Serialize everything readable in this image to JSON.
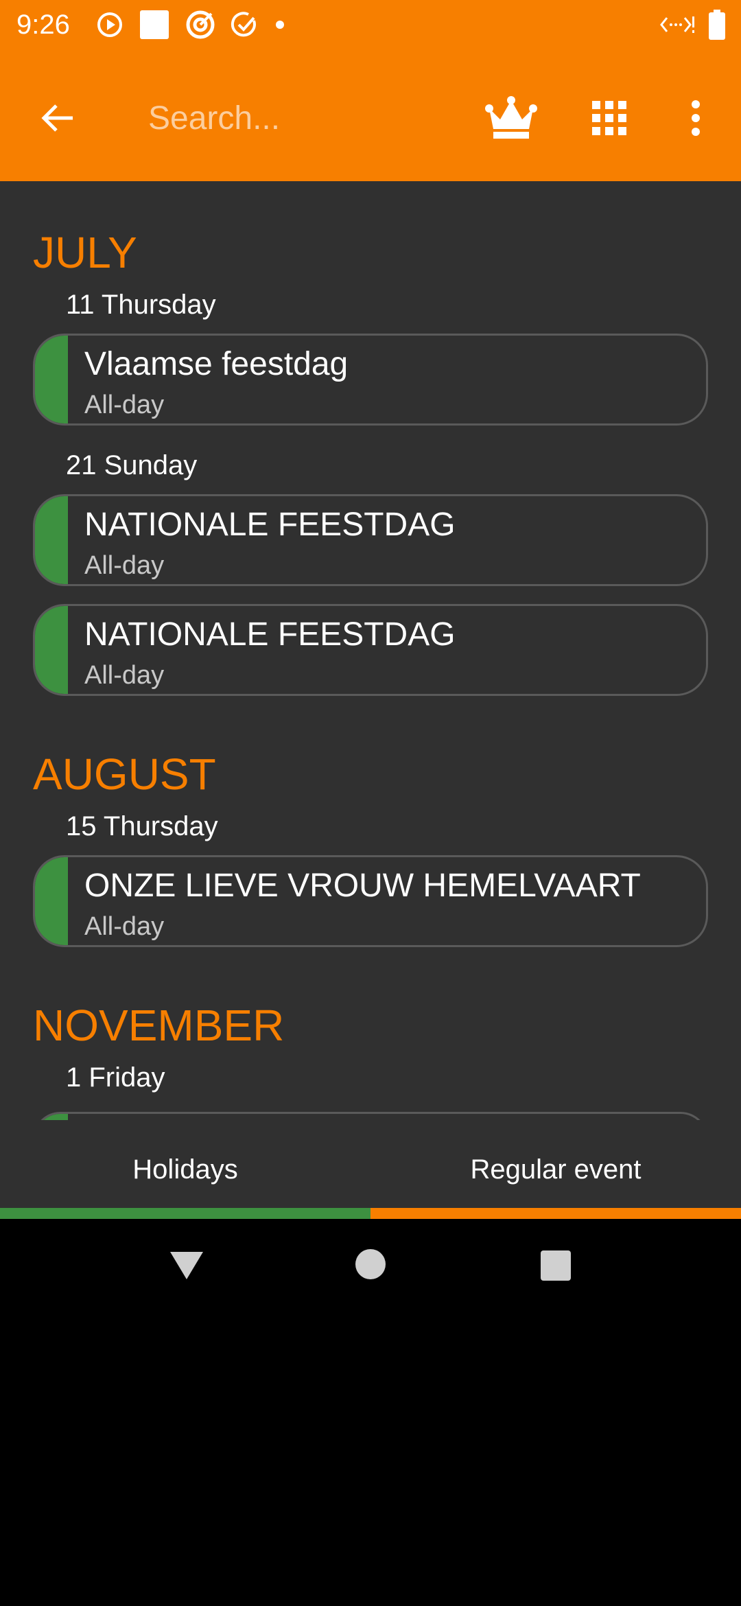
{
  "status_bar": {
    "time": "9:26",
    "left_icons": [
      "play-circle-icon",
      "square-app-icon",
      "target-icon",
      "check-badge-icon",
      "dot-icon"
    ],
    "right_icons": [
      "data-signal-icon",
      "battery-icon"
    ]
  },
  "app_bar": {
    "search_placeholder": "Search...",
    "icons": [
      "back-arrow-icon",
      "crown-icon",
      "grid-icon",
      "more-vert-icon"
    ],
    "color": "#F77F00"
  },
  "sections": [
    {
      "month": "JULY",
      "days": [
        {
          "day": "11 Thursday",
          "events": [
            {
              "title": "Vlaamse feestdag",
              "subtitle": "All-day"
            }
          ]
        },
        {
          "day": "21 Sunday",
          "events": [
            {
              "title": "NATIONALE FEESTDAG",
              "subtitle": "All-day"
            },
            {
              "title": "NATIONALE FEESTDAG",
              "subtitle": "All-day"
            }
          ]
        }
      ]
    },
    {
      "month": "AUGUST",
      "days": [
        {
          "day": "15 Thursday",
          "events": [
            {
              "title": "ONZE LIEVE VROUW HEMELVAART",
              "subtitle": "All-day"
            }
          ]
        }
      ]
    },
    {
      "month": "NOVEMBER",
      "days": [
        {
          "day": "1 Friday"
        }
      ]
    }
  ],
  "tabs": {
    "holidays": "Holidays",
    "regular": "Regular event"
  },
  "colors": {
    "accent_orange": "#F77F00",
    "event_green": "#3D9140",
    "background": "#303030"
  }
}
